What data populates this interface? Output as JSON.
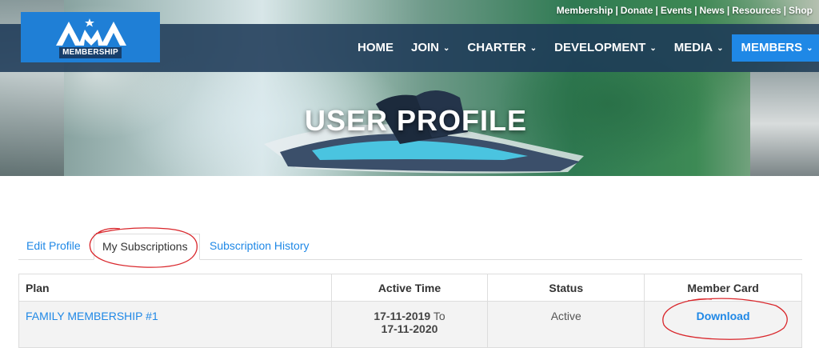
{
  "top_links": [
    "Membership",
    "Donate",
    "Events",
    "News",
    "Resources",
    "Shop"
  ],
  "logo": {
    "text": "MEMBERSHIP"
  },
  "nav": {
    "items": [
      {
        "label": "HOME",
        "dropdown": false,
        "active": false
      },
      {
        "label": "JOIN",
        "dropdown": true,
        "active": false
      },
      {
        "label": "CHARTER",
        "dropdown": true,
        "active": false
      },
      {
        "label": "DEVELOPMENT",
        "dropdown": true,
        "active": false
      },
      {
        "label": "MEDIA",
        "dropdown": true,
        "active": false
      },
      {
        "label": "MEMBERS",
        "dropdown": true,
        "active": true
      }
    ]
  },
  "hero": {
    "title": "USER PROFILE"
  },
  "tabs": [
    {
      "label": "Edit Profile",
      "active": false
    },
    {
      "label": "My Subscriptions",
      "active": true
    },
    {
      "label": "Subscription History",
      "active": false
    }
  ],
  "table": {
    "headers": {
      "plan": "Plan",
      "active_time": "Active Time",
      "status": "Status",
      "member_card": "Member Card"
    },
    "rows": [
      {
        "plan": "FAMILY MEMBERSHIP #1",
        "start": "17-11-2019",
        "to": "To",
        "end": "17-11-2020",
        "status": "Active",
        "card": "Download"
      }
    ]
  },
  "colors": {
    "accent": "#1f88e6",
    "navbar": "#1e3a58",
    "annotation": "#d9262b"
  }
}
